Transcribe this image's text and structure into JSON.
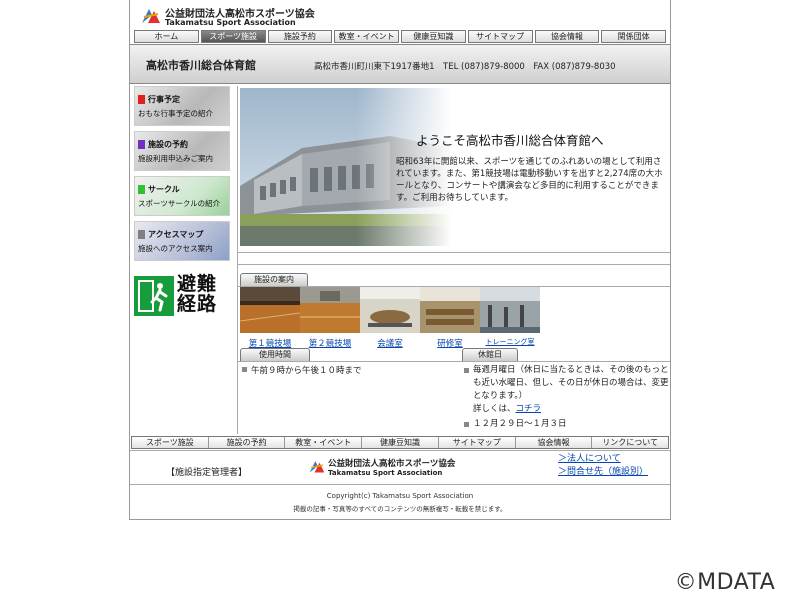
{
  "header": {
    "org_name": "公益財団法人高松市スポーツ協会",
    "org_name_en": "Takamatsu Sport Association"
  },
  "topnav": [
    "ホーム",
    "スポーツ施設",
    "施設予約",
    "教室・イベント",
    "健康豆知識",
    "サイトマップ",
    "協会情報",
    "関係団体"
  ],
  "titlebar": {
    "venue": "高松市香川総合体育館",
    "address": "高松市香川町川東下1917番地1　TEL (087)879-8000　FAX (087)879-8030"
  },
  "sidebar": {
    "items": [
      {
        "title": "行事予定",
        "desc": "おもな行事予定の紹介",
        "color": "#e02020"
      },
      {
        "title": "施設の予約",
        "desc": "施設利用申込みご案内",
        "color": "#7030c0"
      },
      {
        "title": "サークル",
        "desc": "スポーツサークルの紹介",
        "color": "#30c030"
      },
      {
        "title": "アクセスマップ",
        "desc": "施設へのアクセス案内",
        "color": "#808080"
      }
    ],
    "evac_text": "避難経路"
  },
  "hero": {
    "title": "ようこそ高松市香川総合体育館へ",
    "body": "昭和63年に開館以来、スポーツを通じてのふれあいの場として利用されています。また、第1競技場は電動移動いすを出すと2,274席の大ホールとなり、コンサートや講演会など多目的に利用することができます。ご利用お待ちしています。"
  },
  "facilities": {
    "tab_label": "施設の案内",
    "items": [
      "第１競技場",
      "第２競技場",
      "会議室",
      "研修室",
      "トレーニング室"
    ]
  },
  "hours": {
    "tab_label": "使用時間",
    "text": "午前９時から午後１０時まで"
  },
  "holiday": {
    "tab_label": "休館日",
    "text1": "毎週月曜日（休日に当たるときは、その後のもっとも近い水曜日、但し、その日が休日の場合は、変更となります。）",
    "detail_prefix": "詳しくは、",
    "detail_link": "コチラ",
    "text2": "１２月２９日〜１月３日"
  },
  "botnav": [
    "スポーツ施設",
    "施設の予約",
    "教室・イベント",
    "健康豆知識",
    "サイトマップ",
    "協会情報",
    "リンクについて"
  ],
  "footer": {
    "manager_label": "【施設指定管理者】",
    "org_name": "公益財団法人高松市スポーツ協会",
    "org_name_en": "Takamatsu Sport Association",
    "link1": "＞法人について",
    "link2": "＞問合せ先（施設別）",
    "copyright": "Copyright(c) Takamatsu Sport Association",
    "notice": "掲載の記事・写真等のすべてのコンテンツの無断複写・転載を禁じます。"
  },
  "watermark": "©MDATA"
}
